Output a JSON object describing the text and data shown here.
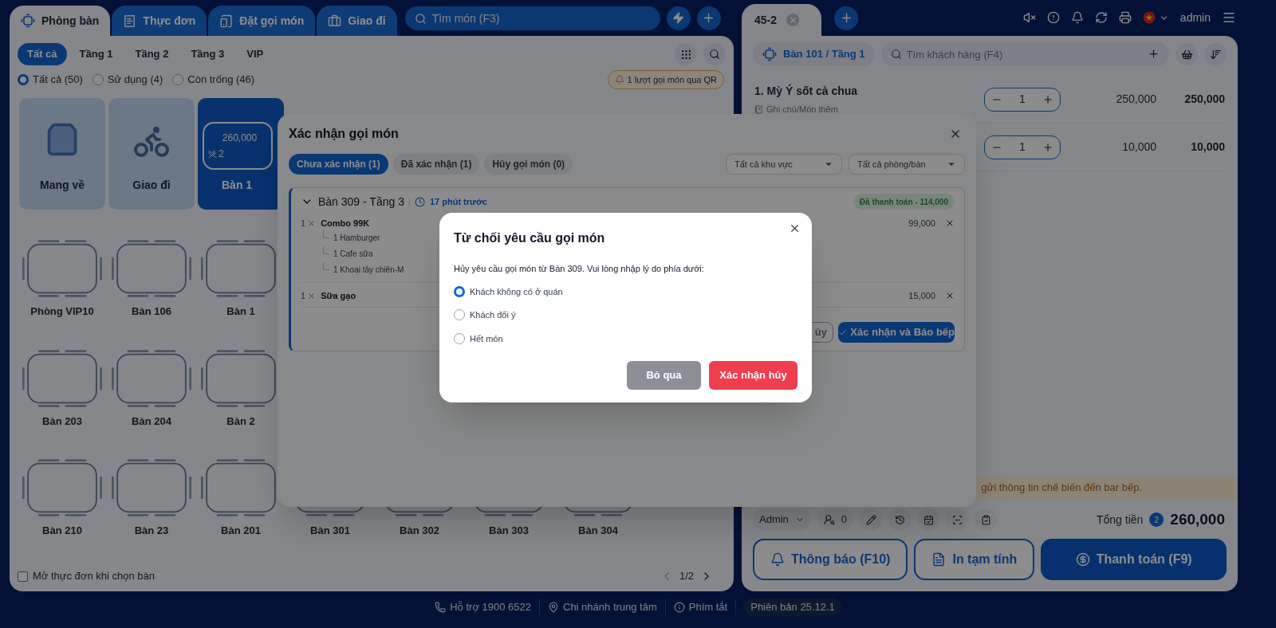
{
  "main_tabs": [
    {
      "label": "Phòng bàn",
      "selected": true
    },
    {
      "label": "Thực đơn",
      "selected": false
    },
    {
      "label": "Đặt gọi món",
      "selected": false
    },
    {
      "label": "Giao đi",
      "selected": false
    }
  ],
  "search": {
    "placeholder": "Tìm món (F3)"
  },
  "floor_tabs": [
    {
      "label": "Tất cả",
      "selected": true
    },
    {
      "label": "Tầng 1",
      "selected": false
    },
    {
      "label": "Tầng 2",
      "selected": false
    },
    {
      "label": "Tầng 3",
      "selected": false
    },
    {
      "label": "VIP",
      "selected": false
    }
  ],
  "status_filters": [
    {
      "label": "Tất cả (50)",
      "selected": true
    },
    {
      "label": "Sử dụng (4)",
      "selected": false
    },
    {
      "label": "Còn trống (46)",
      "selected": false
    }
  ],
  "qr_notice": "1 lượt gọi món qua QR",
  "service_cards": [
    {
      "kind": "takeaway",
      "label": "Mang về",
      "selected": false
    },
    {
      "kind": "delivery",
      "label": "Giao đi",
      "selected": false
    },
    {
      "kind": "table",
      "label": "Bàn 1",
      "amount": "260,000",
      "guests": "2",
      "selected": true
    }
  ],
  "table_rows": [
    [
      {
        "label": "Phòng VIP10"
      },
      {
        "label": "Bàn 106"
      },
      {
        "label": "Bàn 1"
      }
    ],
    [
      {
        "label": "Bàn 203"
      },
      {
        "label": "Bàn 204"
      },
      {
        "label": "Bàn 2"
      }
    ],
    [
      {
        "label": "Bàn 210"
      },
      {
        "label": "Bàn 23"
      },
      {
        "label": "Bàn 201"
      },
      {
        "label": "Bàn 301"
      },
      {
        "label": "Bàn 302"
      },
      {
        "label": "Bàn 303"
      },
      {
        "label": "Bàn 304"
      }
    ]
  ],
  "open_menu_option": {
    "label": "Mở thực đơn khi chọn bàn",
    "checked": false
  },
  "pagination": "1/2",
  "order_tabs": [
    {
      "label": "45-2",
      "selected": true
    }
  ],
  "user": "admin",
  "order": {
    "table": "Bàn 101 / Tầng 1",
    "customer_search": {
      "placeholder": "Tìm khách hàng (F4)"
    },
    "items": [
      {
        "name": "1. Mỳ Ý sốt cà chua",
        "note": "Ghi chú/Món thêm",
        "quantity": "1",
        "price": "250,000",
        "total": "250,000"
      },
      {
        "quantity": "1",
        "price": "10,000",
        "total": "10,000"
      }
    ],
    "notice": "gửi thông tin chế biến đến bar bếp.",
    "staff": "Admin",
    "customer_count": "0",
    "total_label": "Tổng tiền",
    "item_count": "2",
    "total": "260,000",
    "buttons": [
      {
        "kind": "outline",
        "label": "Thông báo (F10)"
      },
      {
        "kind": "outline",
        "label": "In tạm tính"
      },
      {
        "kind": "primary",
        "label": "Thanh toán (F9)"
      }
    ]
  },
  "footer": [
    {
      "kind": "link",
      "label": "Hỗ trợ 1900 6522"
    },
    {
      "kind": "link",
      "label": "Chi nhánh trung tâm"
    },
    {
      "kind": "link",
      "label": "Phím tắt"
    },
    {
      "kind": "pill",
      "label": "Phiên bản 25.12.1"
    }
  ],
  "confirm_dialog": {
    "title": "Xác nhận gọi món",
    "tabs": [
      {
        "label": "Chưa xác nhận (1)",
        "selected": true
      },
      {
        "label": "Đã xác nhận (1)",
        "selected": false
      },
      {
        "label": "Hủy gọi món (0)",
        "selected": false
      }
    ],
    "filters": [
      "Tất cả khu vực",
      "Tất cả phòng/bàn"
    ],
    "order": {
      "table": "Bàn 309 - Tầng 3",
      "time": "17 phút trước",
      "status": "Đã thanh toán - 114,000",
      "items": [
        {
          "quantity": "1",
          "name": "Combo 99K",
          "price": "99,000",
          "children": [
            {
              "name": "1 Hamburger"
            },
            {
              "name": "1 Cafe sữa"
            },
            {
              "name": "1 Khoai tây chiên-M"
            }
          ]
        },
        {
          "quantity": "1",
          "name": "Sữa gạo",
          "price": "15,000"
        }
      ],
      "buttons": [
        {
          "kind": "outline",
          "label": "ủy"
        },
        {
          "kind": "primary",
          "label": "Xác nhận và Báo bếp"
        }
      ]
    }
  },
  "reject_dialog": {
    "title": "Từ chối yêu cầu gọi món",
    "message": "Hủy yêu cầu gọi món từ Bàn 309. Vui lòng nhập lý do phía dưới:",
    "reasons": [
      {
        "label": "Khách không có ở quán",
        "selected": true
      },
      {
        "label": "Khách đổi ý",
        "selected": false
      },
      {
        "label": "Hết món",
        "selected": false
      }
    ],
    "buttons": [
      {
        "kind": "secondary",
        "label": "Bỏ qua"
      },
      {
        "kind": "danger",
        "label": "Xác nhận hủy"
      }
    ]
  }
}
